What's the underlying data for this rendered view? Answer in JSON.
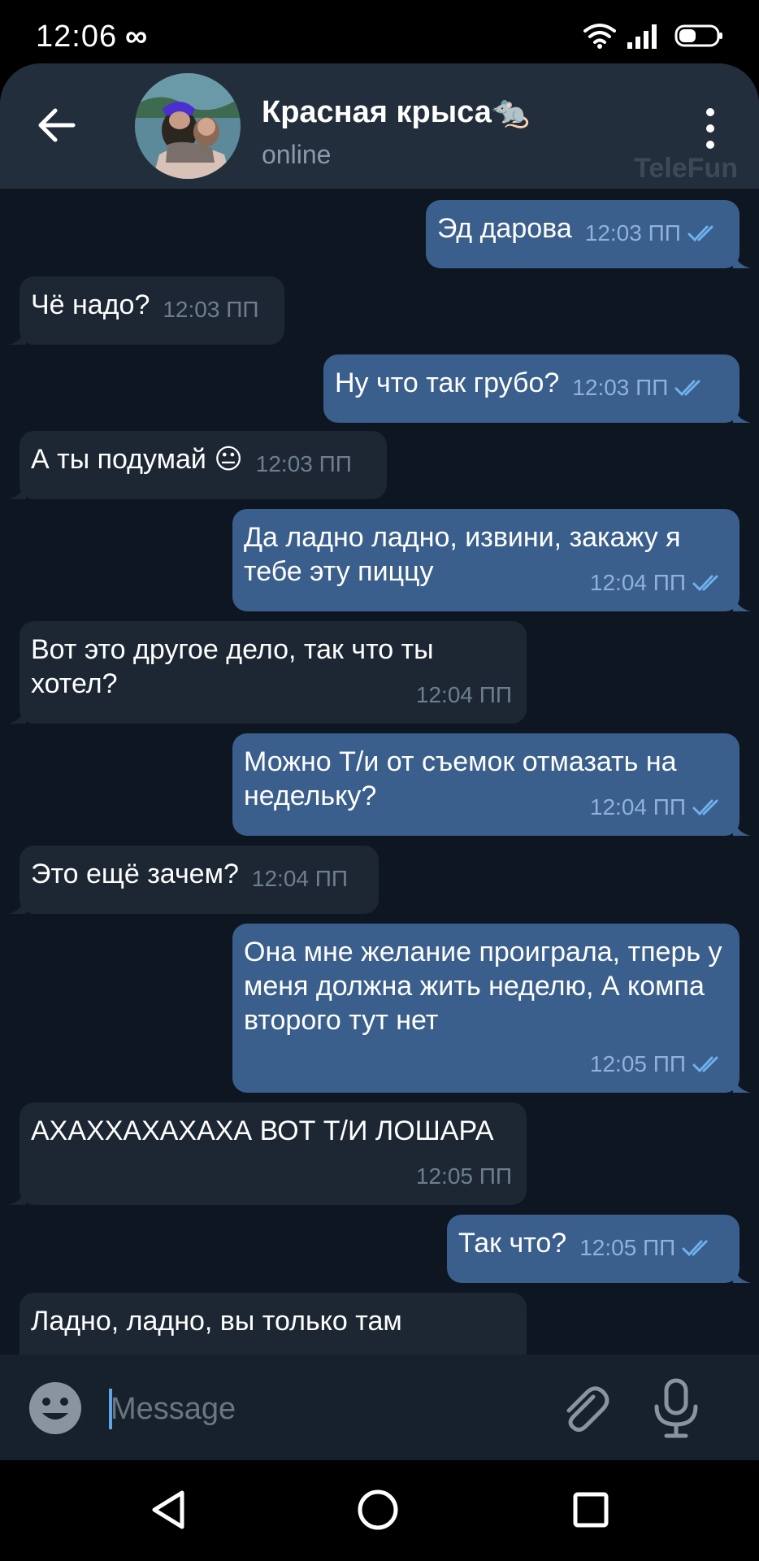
{
  "status_bar": {
    "time": "12:06",
    "infinity": "∞"
  },
  "header": {
    "title": "Красная крыса🐀",
    "status": "online",
    "watermark": "TeleFun"
  },
  "messages": [
    {
      "dir": "out",
      "text": "Эд дарова",
      "time": "12:03 ПП"
    },
    {
      "dir": "in",
      "text": "Чё надо?",
      "time": "12:03 ПП"
    },
    {
      "dir": "out",
      "text": "Ну что так грубо?",
      "time": "12:03 ПП"
    },
    {
      "dir": "in",
      "text": "А ты подумай 😐",
      "time": "12:03 ПП"
    },
    {
      "dir": "out",
      "text": "Да ладно ладно, извини, закажу я тебе эту пиццу",
      "time": "12:04 ПП"
    },
    {
      "dir": "in",
      "text": "Вот это другое дело, так что ты хотел?",
      "time": "12:04 ПП"
    },
    {
      "dir": "out",
      "text": "Можно Т/и от съемок отмазать на недельку?",
      "time": "12:04 ПП"
    },
    {
      "dir": "in",
      "text": "Это ещё зачем?",
      "time": "12:04 ПП"
    },
    {
      "dir": "out",
      "text": "Она мне желание проиграла, тперь у меня должна жить неделю, А компа второго тут нет",
      "time": "12:05 ПП"
    },
    {
      "dir": "in",
      "text": "АХАХХАХАХАХА ВОТ Т/И ЛОШАРА",
      "time": "12:05 ПП"
    },
    {
      "dir": "out",
      "text": "Так что?",
      "time": "12:05 ПП"
    },
    {
      "dir": "in",
      "text": "Ладно, ладно, вы только там",
      "time": ""
    }
  ],
  "input": {
    "placeholder": "Message"
  },
  "icons": {
    "back": "arrow-left-icon",
    "more": "more-vertical-icon",
    "emoji": "emoji-icon",
    "attach": "paperclip-icon",
    "mic": "microphone-icon",
    "read": "double-check-icon"
  },
  "colors": {
    "header_bg": "#232e3c",
    "chat_bg": "#0e1621",
    "bubble_out": "#3a5f8c",
    "bubble_in": "#1c2733",
    "check": "#6fb0ee"
  }
}
